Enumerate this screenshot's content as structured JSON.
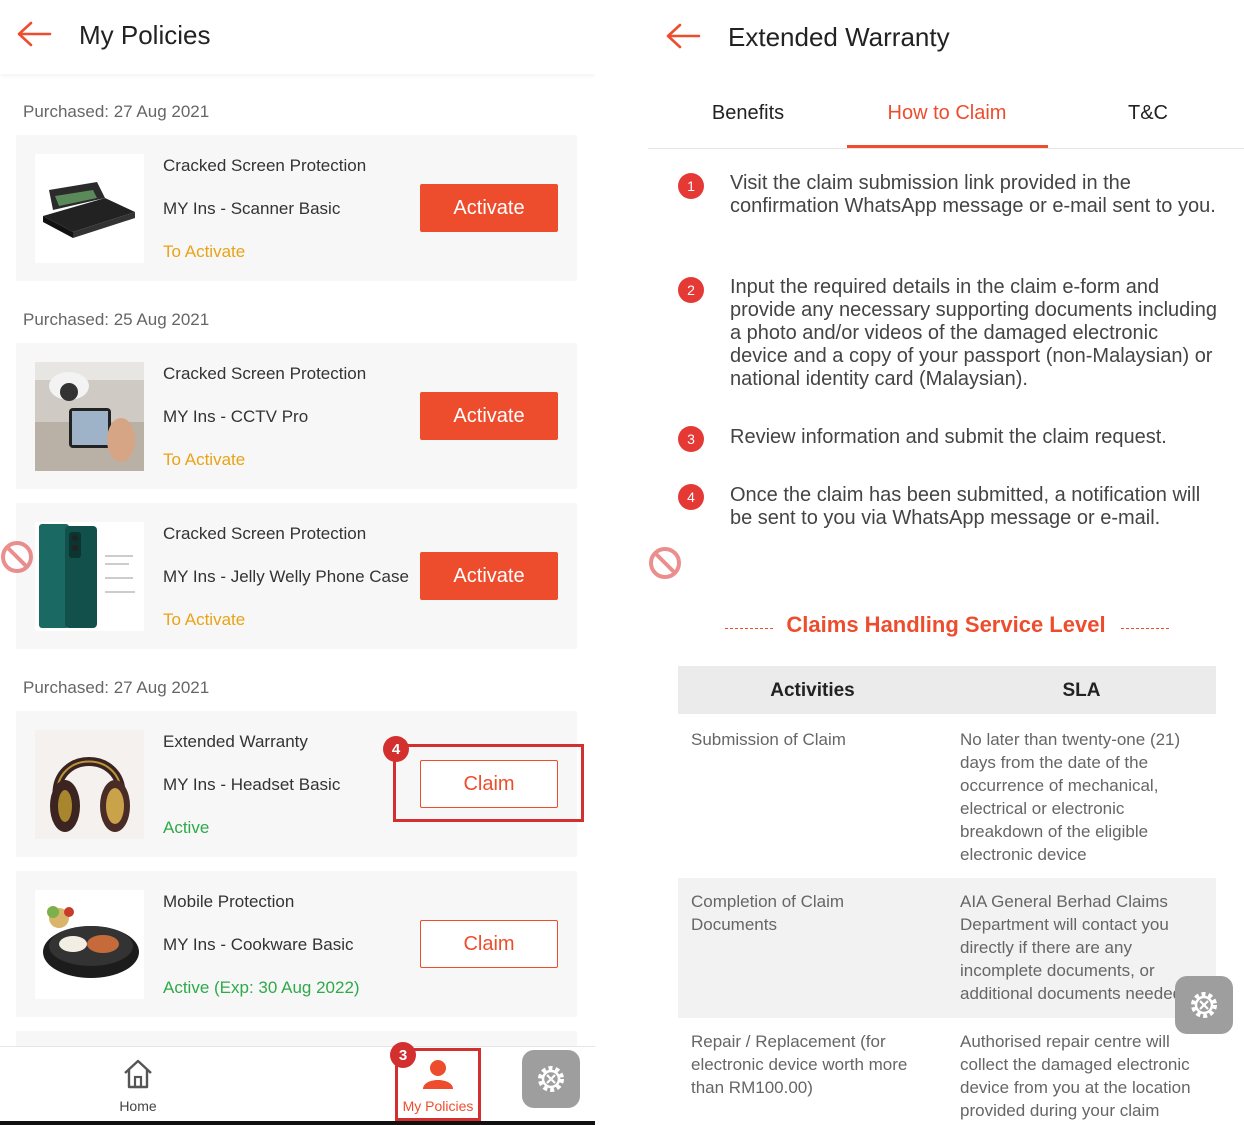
{
  "left": {
    "title": "My Policies",
    "groups": [
      {
        "purchased": "Purchased: 27 Aug 2021"
      },
      {
        "purchased": "Purchased: 25 Aug 2021"
      },
      {
        "purchased": "Purchased: 27 Aug 2021"
      }
    ],
    "cards": [
      {
        "title": "Cracked Screen Protection",
        "plan": "MY Ins - Scanner Basic",
        "status": "To Activate",
        "button": "Activate"
      },
      {
        "title": "Cracked Screen Protection",
        "plan": "MY Ins - CCTV Pro",
        "status": "To Activate",
        "button": "Activate"
      },
      {
        "title": "Cracked Screen Protection",
        "plan": "MY Ins - Jelly Welly Phone Case",
        "status": "To Activate",
        "button": "Activate"
      },
      {
        "title": "Extended Warranty",
        "plan": "MY Ins - Headset Basic",
        "status": "Active",
        "button": "Claim"
      },
      {
        "title": "Mobile Protection",
        "plan": "MY Ins - Cookware Basic",
        "status": "Active (Exp: 30 Aug 2022)",
        "button": "Claim"
      }
    ],
    "annotations": {
      "claim_step": "4",
      "nav_step": "3"
    },
    "nav": {
      "home": "Home",
      "my_policies": "My Policies"
    }
  },
  "right": {
    "title": "Extended Warranty",
    "tabs": [
      "Benefits",
      "How to Claim",
      "T&C"
    ],
    "active_tab": "How to Claim",
    "steps": [
      {
        "num": "1",
        "text": "Visit the claim submission link provided in the confirmation WhatsApp message or e-mail sent to you."
      },
      {
        "num": "2",
        "text": "Input the required details in the claim e-form and provide any necessary supporting documents including a photo and/or videos of the damaged electronic device and a copy of your passport (non-Malaysian) or national identity card (Malaysian)."
      },
      {
        "num": "3",
        "text": "Review information and submit the claim request."
      },
      {
        "num": "4",
        "text": "Once the claim has been submitted, a notification will be sent to you via WhatsApp message or e-mail."
      }
    ],
    "sla_title": "Claims Handling Service Level",
    "sla_headers": [
      "Activities",
      "SLA"
    ],
    "sla_rows": [
      {
        "activity": "Submission of Claim",
        "sla": "No later than twenty-one (21) days from the date of the occurrence of mechanical, electrical or electronic breakdown of the eligible electronic device"
      },
      {
        "activity": "Completion of Claim Documents",
        "sla": "AIA General Berhad Claims Department will contact you directly if there are any incomplete documents, or additional documents needed"
      },
      {
        "activity": "Repair / Replacement (for electronic device worth more than RM100.00)",
        "sla": "Authorised repair centre will collect the damaged electronic device from you at the location provided during your claim"
      }
    ]
  },
  "colors": {
    "accent": "#ee4d2d",
    "highlight": "#d32f2f",
    "to_activate": "#e8a317",
    "active": "#2eaa4a"
  },
  "icons": [
    "back-arrow-icon",
    "home-icon",
    "person-icon",
    "gear-icon",
    "no-entry-icon"
  ]
}
